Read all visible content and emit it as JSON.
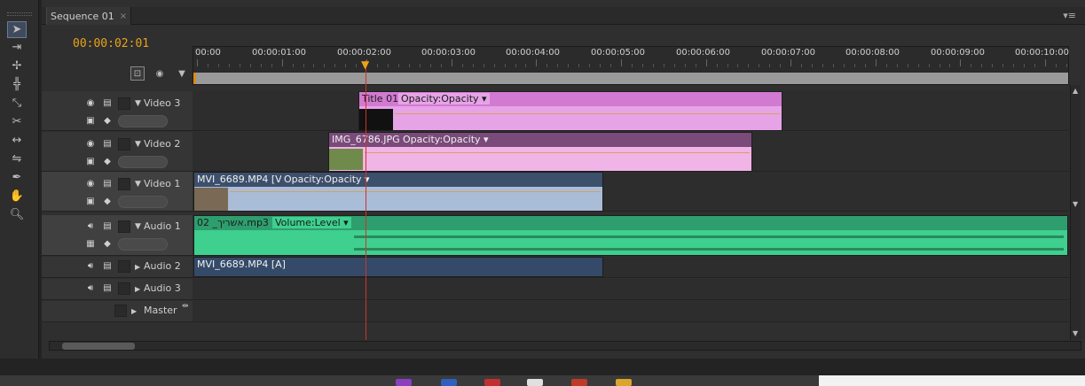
{
  "panel": {
    "tab_label": "Sequence 01",
    "tab_close": "×",
    "menu_glyph": "▾≡"
  },
  "timecode": "00:00:02:01",
  "ruler": {
    "labels": [
      "00:00",
      "00:00:01:00",
      "00:00:02:00",
      "00:00:03:00",
      "00:00:04:00",
      "00:00:05:00",
      "00:00:06:00",
      "00:00:07:00",
      "00:00:08:00",
      "00:00:09:00",
      "00:00:10:00"
    ]
  },
  "tracks": {
    "video3": {
      "name": "Video 3"
    },
    "video2": {
      "name": "Video 2"
    },
    "video1": {
      "name": "Video 1"
    },
    "audio1": {
      "name": "Audio 1"
    },
    "audio2": {
      "name": "Audio 2"
    },
    "audio3": {
      "name": "Audio 3"
    },
    "master": {
      "name": "Master"
    }
  },
  "clips": {
    "title01": {
      "name": "Title 01",
      "effect": "Opacity:Opacity ▾"
    },
    "img6786": {
      "name": "IMG_6786.JPG",
      "effect": "Opacity:Opacity ▾"
    },
    "mvi_v": {
      "name": "MVI_6689.MP4 [V]",
      "effect": "Opacity:Opacity ▾"
    },
    "mp3": {
      "name": "02 _אשריך.mp3",
      "effect": "Volume:Level ▾"
    },
    "mvi_a": {
      "name": "MVI_6689.MP4 [A]"
    }
  },
  "colors": {
    "title_clip": "#e6a3e6",
    "title_clip_header": "#d27ad2",
    "img_clip": "#f0b4e6",
    "img_clip_header": "#7a4a7a",
    "video_clip": "#a9bcd8",
    "video_clip_header": "#3c4f6b",
    "audio_clip": "#3fcf8f",
    "audio_clip_header": "#2e9e6e",
    "audio2_clip": "#344a68",
    "playhead": "#d1322a",
    "timecode": "#e8a317"
  },
  "tools": [
    "selection-tool",
    "track-select-tool",
    "ripple-edit-tool",
    "rolling-edit-tool",
    "rate-stretch-tool",
    "razor-tool",
    "slip-tool",
    "slide-tool",
    "pen-tool",
    "hand-tool",
    "zoom-tool"
  ]
}
